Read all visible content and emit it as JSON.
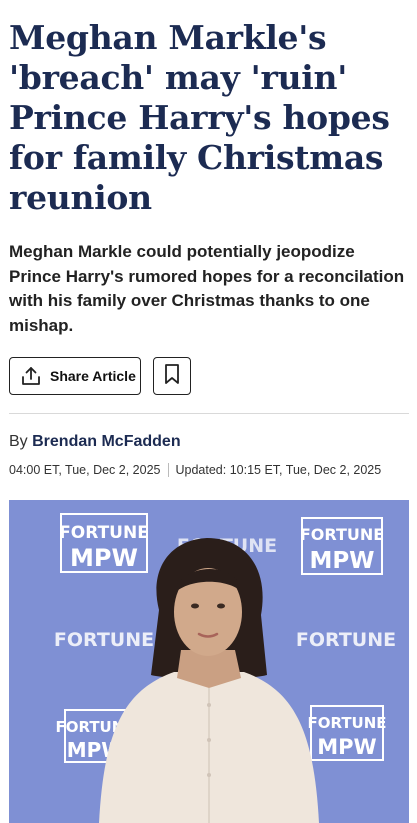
{
  "article": {
    "headline": "Meghan Markle's 'breach' may 'ruin' Prince Harry's hopes for family Christmas reunion",
    "dek": "Meghan Markle could potentially jeopodize Prince Harry's rumored hopes for a reconcilation with his family over Christmas thanks to one mishap.",
    "share_label": "Share Article",
    "byline_prefix": "By",
    "author": "Brendan McFadden",
    "published": "04:00 ET, Tue, Dec 2, 2025",
    "updated": "Updated: 10:15 ET, Tue, Dec 2, 2025"
  },
  "photo": {
    "backdrop_text_fortune": "FORTUNE",
    "backdrop_text_mpw": "MPW",
    "backdrop_color": "#7f90d4"
  },
  "colors": {
    "headline": "#1c2b52",
    "author": "#1c2b52"
  },
  "icons": {
    "share": "share-icon",
    "bookmark": "bookmark-icon"
  }
}
